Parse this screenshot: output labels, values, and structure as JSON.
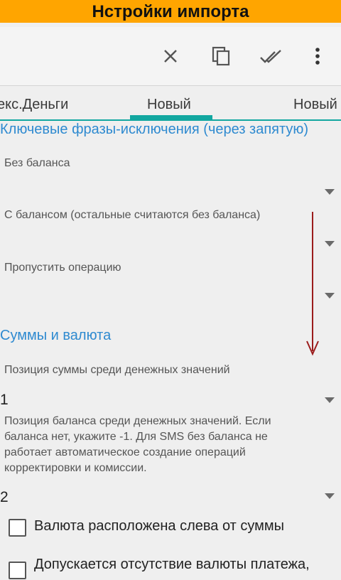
{
  "banner": {
    "title": "Нстройки импорта"
  },
  "toolbar": {
    "icons": [
      "close-icon",
      "copy-icon",
      "done-all-icon",
      "more-vert-icon"
    ]
  },
  "tabs": [
    {
      "label": "екс.Деньги"
    },
    {
      "label": "Новый",
      "selected": true
    },
    {
      "label": "Новый"
    }
  ],
  "exclusions": {
    "title": "Ключевые фразы-исключения (через запятую)",
    "fields": [
      {
        "label": "Без баланса"
      },
      {
        "label": "С балансом (остальные считаются без баланса)"
      },
      {
        "label": "Пропустить операцию"
      }
    ]
  },
  "amounts": {
    "title": "Суммы и валюта",
    "sum_position": {
      "label": "Позиция суммы среди денежных значений",
      "value": "1"
    },
    "balance_position": {
      "description": "Позиция баланса среди денежных значений. Если баланса нет, укажите -1. Для SMS без баланса не работает автоматическое создание операций корректировки и комиссии.",
      "value": "2"
    },
    "checkboxes": [
      {
        "label": "Валюта расположена слева от суммы",
        "checked": false
      },
      {
        "label": "Допускается отсутствие валюты платежа,",
        "checked": false
      }
    ]
  },
  "colors": {
    "banner": "#ffa500",
    "accent_tab": "#12a7a0",
    "section_title": "#2e8ad0",
    "scroll_arrow": "#9b1c1c"
  }
}
